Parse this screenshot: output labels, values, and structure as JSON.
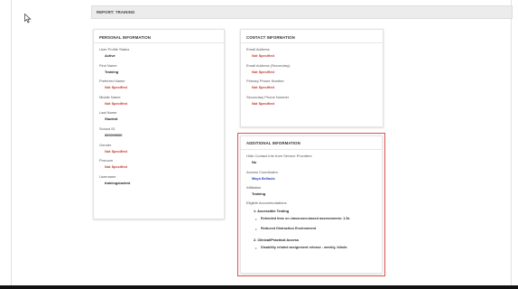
{
  "report": {
    "title": "REPORT: TRAINING"
  },
  "personal": {
    "title": "PERSONAL INFORMATION",
    "fields": [
      {
        "label": "User Profile Status",
        "value": "Active",
        "style": "dark"
      },
      {
        "label": "First Name",
        "value": "Training",
        "style": "dark"
      },
      {
        "label": "Preferred Name",
        "value": "Not Specified",
        "style": "red"
      },
      {
        "label": "Middle Name",
        "value": "Not Specified",
        "style": "red"
      },
      {
        "label": "Last Name",
        "value": "Student",
        "style": "dark"
      },
      {
        "label": "School ID",
        "value": "000000000",
        "style": "dark"
      },
      {
        "label": "Gender",
        "value": "Not Specified",
        "style": "red"
      },
      {
        "label": "Pronoun",
        "value": "Not Specified",
        "style": "red"
      },
      {
        "label": "Username",
        "value": "trainingstudent",
        "style": "dark"
      }
    ]
  },
  "contact": {
    "title": "CONTACT INFORMATION",
    "fields": [
      {
        "label": "Email Address",
        "value": "Not Specified",
        "style": "red"
      },
      {
        "label": "Email Address (Secondary)",
        "value": "Not Specified",
        "style": "red"
      },
      {
        "label": "Primary Phone Number",
        "value": "Not Specified",
        "style": "red"
      },
      {
        "label": "Secondary Phone Number",
        "value": "Not Specified",
        "style": "red"
      }
    ]
  },
  "additional": {
    "title": "ADDITIONAL INFORMATION",
    "fields": [
      {
        "label": "Hide Contact Info from Service Providers",
        "value": "No",
        "style": "dark"
      },
      {
        "label": "Access Coordinator",
        "value": "Maya Bellavia",
        "style": "blue"
      },
      {
        "label": "Affiliation",
        "value": "Training",
        "style": "dark"
      }
    ],
    "accommodations_label": "Eligible Accommodations",
    "groups": [
      {
        "name": "1. Accessible Testing",
        "items": [
          "Extended time on classroom-based assessments: 1.5x",
          "Reduced Distraction Environment"
        ]
      },
      {
        "name": "2. Clinical/Practical Access",
        "items": [
          "Disability related assignment release - weekly, blinds"
        ]
      }
    ]
  },
  "icons": {
    "cursor": "mouse-pointer-icon",
    "bullet": "bullet-icon"
  },
  "colors": {
    "not_specified": "#c0392b",
    "link": "#2a4fb3",
    "highlight_border": "#d9534f"
  }
}
